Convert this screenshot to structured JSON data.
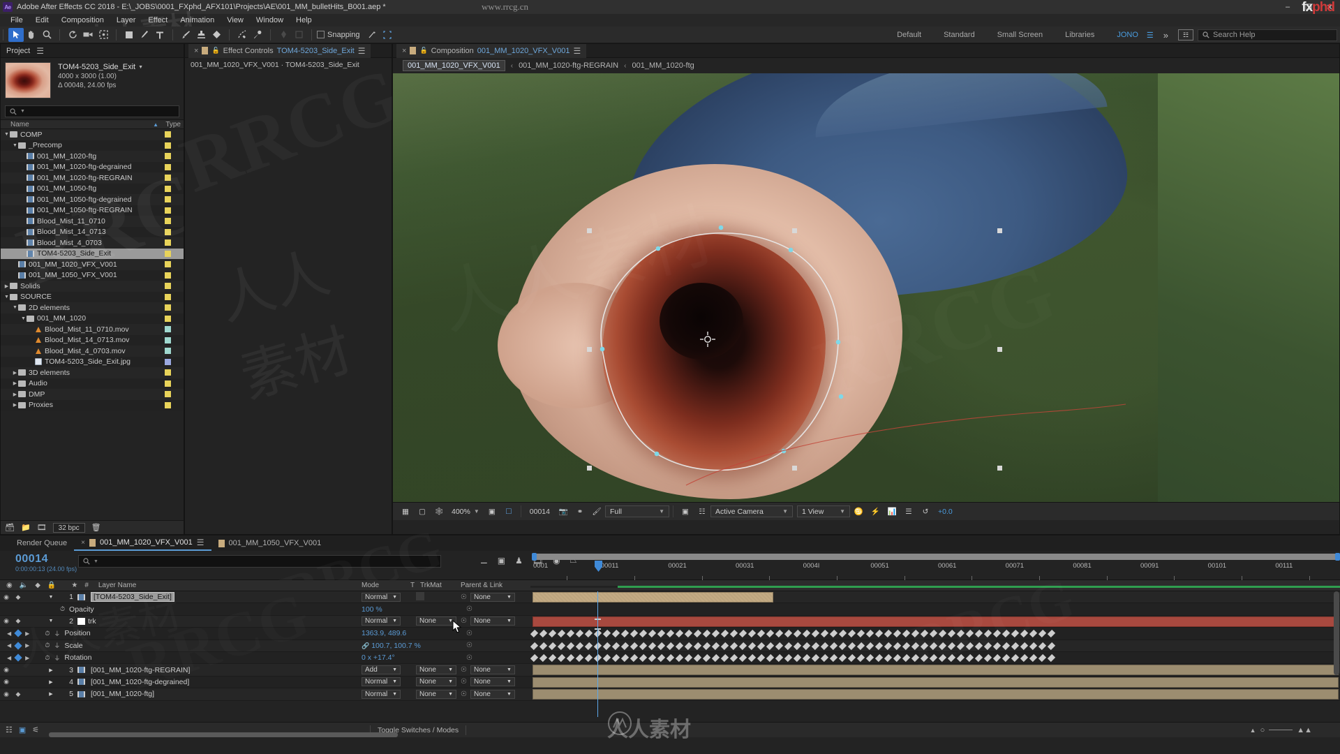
{
  "window": {
    "title": "Adobe After Effects CC 2018 - E:\\_JOBS\\0001_FXphd_AFX101\\Projects\\AE\\001_MM_bulletHits_B001.aep *",
    "app_badge": "Ae",
    "minimize": "–",
    "maximize": "❐",
    "close": "✕",
    "watermark_url": "www.rrcg.cn",
    "brand_fx": "fx",
    "brand_phd": "phd"
  },
  "menu": {
    "items": [
      "File",
      "Edit",
      "Composition",
      "Layer",
      "Effect",
      "Animation",
      "View",
      "Window",
      "Help"
    ]
  },
  "toolbar": {
    "snapping_label": "Snapping",
    "tools": [
      "selection-tool",
      "hand-tool",
      "zoom-tool",
      "rotation-tool",
      "camera-tool",
      "pan-behind-tool",
      "shape-tool",
      "pen-tool",
      "text-tool",
      "brush-tool",
      "clone-stamp-tool",
      "eraser-tool",
      "roto-brush-tool",
      "puppet-pin-tool"
    ],
    "workspaces": [
      "Default",
      "Standard",
      "Small Screen",
      "Libraries"
    ],
    "user": "JONO",
    "search_placeholder": "Search Help"
  },
  "project": {
    "tab_label": "Project",
    "selected_item": {
      "name": "TOM4-5203_Side_Exit",
      "dimensions": "4000 x 3000 (1.00)",
      "duration": "Δ 00048, 24.00 fps"
    },
    "search_placeholder": "",
    "columns": {
      "name": "Name",
      "type": "Type"
    },
    "bit_depth": "32 bpc",
    "items": [
      {
        "label": "COMP",
        "indent": 0,
        "kind": "folder",
        "twirl": "down",
        "color": "lb-yellow"
      },
      {
        "label": "_Precomp",
        "indent": 1,
        "kind": "folder",
        "twirl": "down",
        "color": "lb-yellow"
      },
      {
        "label": "001_MM_1020-ftg",
        "indent": 2,
        "kind": "comp",
        "twirl": "",
        "color": "lb-yellow"
      },
      {
        "label": "001_MM_1020-ftg-degrained",
        "indent": 2,
        "kind": "comp",
        "twirl": "",
        "color": "lb-yellow"
      },
      {
        "label": "001_MM_1020-ftg-REGRAIN",
        "indent": 2,
        "kind": "comp",
        "twirl": "",
        "color": "lb-yellow"
      },
      {
        "label": "001_MM_1050-ftg",
        "indent": 2,
        "kind": "comp",
        "twirl": "",
        "color": "lb-yellow"
      },
      {
        "label": "001_MM_1050-ftg-degrained",
        "indent": 2,
        "kind": "comp",
        "twirl": "",
        "color": "lb-yellow"
      },
      {
        "label": "001_MM_1050-ftg-REGRAIN",
        "indent": 2,
        "kind": "comp",
        "twirl": "",
        "color": "lb-yellow"
      },
      {
        "label": "Blood_Mist_11_0710",
        "indent": 2,
        "kind": "comp",
        "twirl": "",
        "color": "lb-yellow"
      },
      {
        "label": "Blood_Mist_14_0713",
        "indent": 2,
        "kind": "comp",
        "twirl": "",
        "color": "lb-yellow"
      },
      {
        "label": "Blood_Mist_4_0703",
        "indent": 2,
        "kind": "comp",
        "twirl": "",
        "color": "lb-yellow"
      },
      {
        "label": "TOM4-5203_Side_Exit",
        "indent": 2,
        "kind": "comp",
        "twirl": "",
        "color": "lb-yellow",
        "selected": true
      },
      {
        "label": "001_MM_1020_VFX_V001",
        "indent": 1,
        "kind": "comp",
        "twirl": "",
        "color": "lb-yellow"
      },
      {
        "label": "001_MM_1050_VFX_V001",
        "indent": 1,
        "kind": "comp",
        "twirl": "",
        "color": "lb-yellow"
      },
      {
        "label": "Solids",
        "indent": 0,
        "kind": "folder",
        "twirl": "right",
        "color": "lb-yellow"
      },
      {
        "label": "SOURCE",
        "indent": 0,
        "kind": "folder",
        "twirl": "down",
        "color": "lb-yellow"
      },
      {
        "label": "2D elements",
        "indent": 1,
        "kind": "folder",
        "twirl": "down",
        "color": "lb-yellow"
      },
      {
        "label": "001_MM_1020",
        "indent": 2,
        "kind": "folder",
        "twirl": "down",
        "color": "lb-yellow"
      },
      {
        "label": "Blood_Mist_11_0710.mov",
        "indent": 3,
        "kind": "mov",
        "twirl": "",
        "color": "lb-teal"
      },
      {
        "label": "Blood_Mist_14_0713.mov",
        "indent": 3,
        "kind": "mov",
        "twirl": "",
        "color": "lb-teal"
      },
      {
        "label": "Blood_Mist_4_0703.mov",
        "indent": 3,
        "kind": "mov",
        "twirl": "",
        "color": "lb-teal"
      },
      {
        "label": "TOM4-5203_Side_Exit.jpg",
        "indent": 3,
        "kind": "jpg",
        "twirl": "",
        "color": "lb-blue"
      },
      {
        "label": "3D elements",
        "indent": 1,
        "kind": "folder",
        "twirl": "right",
        "color": "lb-yellow"
      },
      {
        "label": "Audio",
        "indent": 1,
        "kind": "folder",
        "twirl": "right",
        "color": "lb-yellow"
      },
      {
        "label": "DMP",
        "indent": 1,
        "kind": "folder",
        "twirl": "right",
        "color": "lb-yellow"
      },
      {
        "label": "Proxies",
        "indent": 1,
        "kind": "folder",
        "twirl": "right",
        "color": "lb-yellow"
      }
    ]
  },
  "effect_controls": {
    "tab_prefix": "Effect Controls",
    "tab_target": "TOM4-5203_Side_Exit",
    "subtitle": "001_MM_1020_VFX_V001 · TOM4-5203_Side_Exit",
    "close": "×"
  },
  "composition": {
    "tab_prefix": "Composition",
    "tab_target": "001_MM_1020_VFX_V001",
    "close": "×",
    "breadcrumb": [
      "001_MM_1020_VFX_V001",
      "001_MM_1020-ftg-REGRAIN",
      "001_MM_1020-ftg"
    ],
    "breadcrumb_sep": "‹",
    "footer": {
      "magnification": "400%",
      "timecode": "00014",
      "resolution": "Full",
      "camera": "Active Camera",
      "views": "1 View",
      "exposure": "+0.0"
    }
  },
  "timeline": {
    "tabs": [
      {
        "label": "Render Queue",
        "selected": false,
        "swatch": false
      },
      {
        "label": "001_MM_1020_VFX_V001",
        "selected": true,
        "swatch": true
      },
      {
        "label": "001_MM_1050_VFX_V001",
        "selected": false,
        "swatch": true
      }
    ],
    "current_time": "00014",
    "current_time_sub": "0:00:00:13 (24.00 fps)",
    "search_placeholder": "",
    "columns": {
      "layer_name": "Layer Name",
      "mode": "Mode",
      "t": "T",
      "trkmat": "TrkMat",
      "parent": "Parent & Link"
    },
    "ruler_ticks": [
      "0001",
      "00011",
      "00021",
      "00031",
      "0004I",
      "00051",
      "00061",
      "00071",
      "00081",
      "00091",
      "00101",
      "00111"
    ],
    "rows": [
      {
        "type": "layer",
        "num": "1",
        "name": "[TOM4-5203_Side_Exit]",
        "mode": "Normal",
        "trkmat": "",
        "parent": "None",
        "label": "tan",
        "eye": true,
        "audio": true,
        "twirl": "down",
        "selected": true
      },
      {
        "type": "prop",
        "name": "Opacity",
        "value": "100 %"
      },
      {
        "type": "layer",
        "num": "2",
        "name": "trk",
        "mode": "Normal",
        "trkmat": "None",
        "parent": "None",
        "label": "red",
        "eye": true,
        "audio": true,
        "twirl": "down",
        "white_src": true
      },
      {
        "type": "prop",
        "name": "Position",
        "value": "1363.9, 489.6",
        "keys": true
      },
      {
        "type": "prop",
        "name": "Scale",
        "value": "100.7, 100.7 %",
        "keys": true,
        "linked": true
      },
      {
        "type": "prop",
        "name": "Rotation",
        "value": "0 x +17.4°",
        "keys": true
      },
      {
        "type": "layer",
        "num": "3",
        "name": "[001_MM_1020-ftg-REGRAIN]",
        "mode": "Add",
        "trkmat": "None",
        "parent": "None",
        "label": "tan",
        "eye": true,
        "twirl": "right"
      },
      {
        "type": "layer",
        "num": "4",
        "name": "[001_MM_1020-ftg-degrained]",
        "mode": "Normal",
        "trkmat": "None",
        "parent": "None",
        "label": "tan",
        "eye": true,
        "twirl": "right"
      },
      {
        "type": "layer",
        "num": "5",
        "name": "[001_MM_1020-ftg]",
        "mode": "Normal",
        "trkmat": "None",
        "parent": "None",
        "label": "tan",
        "eye": true,
        "audio": true,
        "twirl": "right"
      }
    ],
    "footer": {
      "toggle_switches": "Toggle Switches / Modes"
    }
  },
  "icons": {
    "search": "⌕",
    "hamburger": "☰",
    "chevron_down": "▾",
    "chevron_right": "▸",
    "lock": "🔒",
    "stopwatch": "⏱",
    "eye": "◉",
    "speaker": "◈",
    "pick_whip": "@"
  }
}
